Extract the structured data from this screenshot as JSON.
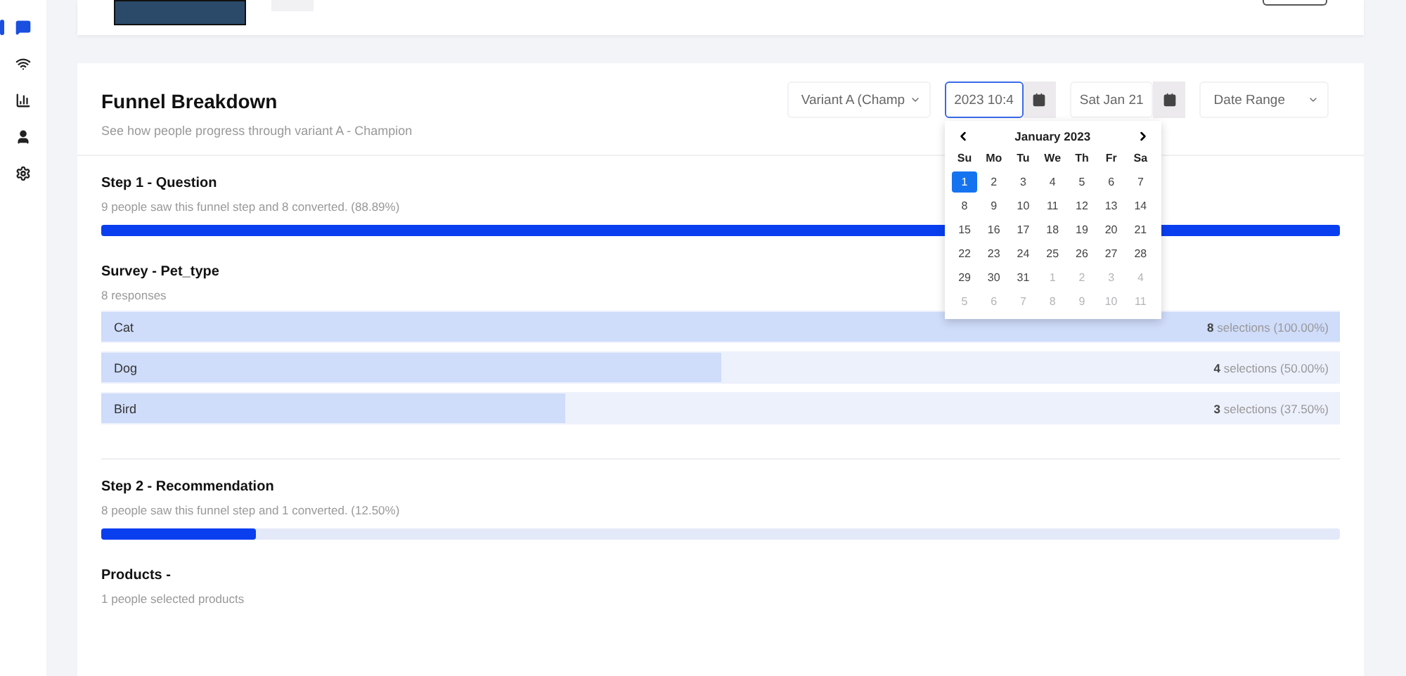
{
  "sidebar": {
    "items": [
      {
        "selected": true
      },
      {
        "selected": false
      },
      {
        "selected": false
      },
      {
        "selected": false
      },
      {
        "selected": false
      }
    ]
  },
  "funnel": {
    "title": "Funnel Breakdown",
    "subtitle": "See how people progress through variant A - Champion",
    "controls": {
      "variant": "Variant A (Champ",
      "start_date": "2023 10:4",
      "end_date": "Sat Jan 21",
      "range": "Date Range"
    },
    "calendar": {
      "month": "January 2023",
      "weekdays": [
        "Su",
        "Mo",
        "Tu",
        "We",
        "Th",
        "Fr",
        "Sa"
      ],
      "weeks": [
        [
          {
            "label": "1",
            "selected": true,
            "muted": false
          },
          {
            "label": "2",
            "selected": false,
            "muted": false
          },
          {
            "label": "3",
            "selected": false,
            "muted": false
          },
          {
            "label": "4",
            "selected": false,
            "muted": false
          },
          {
            "label": "5",
            "selected": false,
            "muted": false
          },
          {
            "label": "6",
            "selected": false,
            "muted": false
          },
          {
            "label": "7",
            "selected": false,
            "muted": false
          }
        ],
        [
          {
            "label": "8",
            "selected": false,
            "muted": false
          },
          {
            "label": "9",
            "selected": false,
            "muted": false
          },
          {
            "label": "10",
            "selected": false,
            "muted": false
          },
          {
            "label": "11",
            "selected": false,
            "muted": false
          },
          {
            "label": "12",
            "selected": false,
            "muted": false
          },
          {
            "label": "13",
            "selected": false,
            "muted": false
          },
          {
            "label": "14",
            "selected": false,
            "muted": false
          }
        ],
        [
          {
            "label": "15",
            "selected": false,
            "muted": false
          },
          {
            "label": "16",
            "selected": false,
            "muted": false
          },
          {
            "label": "17",
            "selected": false,
            "muted": false
          },
          {
            "label": "18",
            "selected": false,
            "muted": false
          },
          {
            "label": "19",
            "selected": false,
            "muted": false
          },
          {
            "label": "20",
            "selected": false,
            "muted": false
          },
          {
            "label": "21",
            "selected": false,
            "muted": false
          }
        ],
        [
          {
            "label": "22",
            "selected": false,
            "muted": false
          },
          {
            "label": "23",
            "selected": false,
            "muted": false
          },
          {
            "label": "24",
            "selected": false,
            "muted": false
          },
          {
            "label": "25",
            "selected": false,
            "muted": false
          },
          {
            "label": "26",
            "selected": false,
            "muted": false
          },
          {
            "label": "27",
            "selected": false,
            "muted": false
          },
          {
            "label": "28",
            "selected": false,
            "muted": false
          }
        ],
        [
          {
            "label": "29",
            "selected": false,
            "muted": false
          },
          {
            "label": "30",
            "selected": false,
            "muted": false
          },
          {
            "label": "31",
            "selected": false,
            "muted": false
          },
          {
            "label": "1",
            "selected": false,
            "muted": true
          },
          {
            "label": "2",
            "selected": false,
            "muted": true
          },
          {
            "label": "3",
            "selected": false,
            "muted": true
          },
          {
            "label": "4",
            "selected": false,
            "muted": true
          }
        ],
        [
          {
            "label": "5",
            "selected": false,
            "muted": true
          },
          {
            "label": "6",
            "selected": false,
            "muted": true
          },
          {
            "label": "7",
            "selected": false,
            "muted": true
          },
          {
            "label": "8",
            "selected": false,
            "muted": true
          },
          {
            "label": "9",
            "selected": false,
            "muted": true
          },
          {
            "label": "10",
            "selected": false,
            "muted": true
          },
          {
            "label": "11",
            "selected": false,
            "muted": true
          }
        ]
      ]
    },
    "sections": [
      {
        "kind": "step",
        "title": "Step 1 - Question",
        "summary": "9 people saw this funnel step and 8 converted. (88.89%)",
        "level": 1
      },
      {
        "kind": "survey",
        "title": "Survey - Pet_type",
        "summary": "8 responses",
        "options": [
          {
            "label": "Cat",
            "count": "**8** selections (100.00%)",
            "level": 1
          },
          {
            "label": "Dog",
            "count": "**4** selections (50.00%)",
            "level": 0.5
          },
          {
            "label": "Bird",
            "count": "**3** selections (37.50%)",
            "level": 0.375
          }
        ]
      },
      {
        "kind": "step",
        "title": "Step 2 - Recommendation",
        "summary": "8 people saw this funnel step and 1 converted. (12.50%)",
        "level": 0.125
      },
      {
        "kind": "products",
        "title": "Products -",
        "summary": "1 people selected products"
      }
    ]
  }
}
